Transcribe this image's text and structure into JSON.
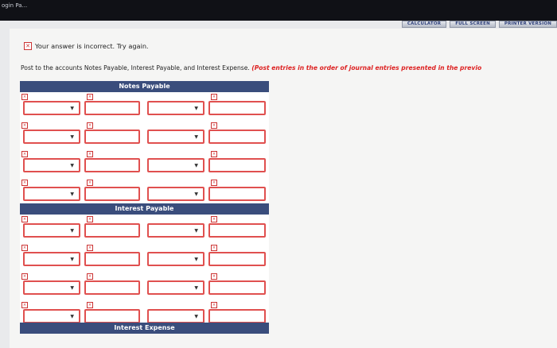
{
  "browser": {
    "tab_title": "ogin Pa..."
  },
  "toolbar": {
    "calculator": "CALCULATOR",
    "full_screen": "FULL SCREEN",
    "printer_version": "PRINTER VERSION"
  },
  "feedback": {
    "message": "Your answer is incorrect.  Try again."
  },
  "instructions": {
    "text": "Post to the accounts Notes Payable, Interest Payable, and Interest Expense.",
    "note": "(Post entries in the order of journal entries presented in the previo"
  },
  "ledgers": [
    {
      "title": "Notes Payable",
      "rows": 4
    },
    {
      "title": "Interest Payable",
      "rows": 4
    },
    {
      "title": "Interest Expense",
      "rows": 0
    }
  ],
  "colors": {
    "header": "#3a4d7c",
    "error": "#e0504f",
    "note": "#d22"
  }
}
